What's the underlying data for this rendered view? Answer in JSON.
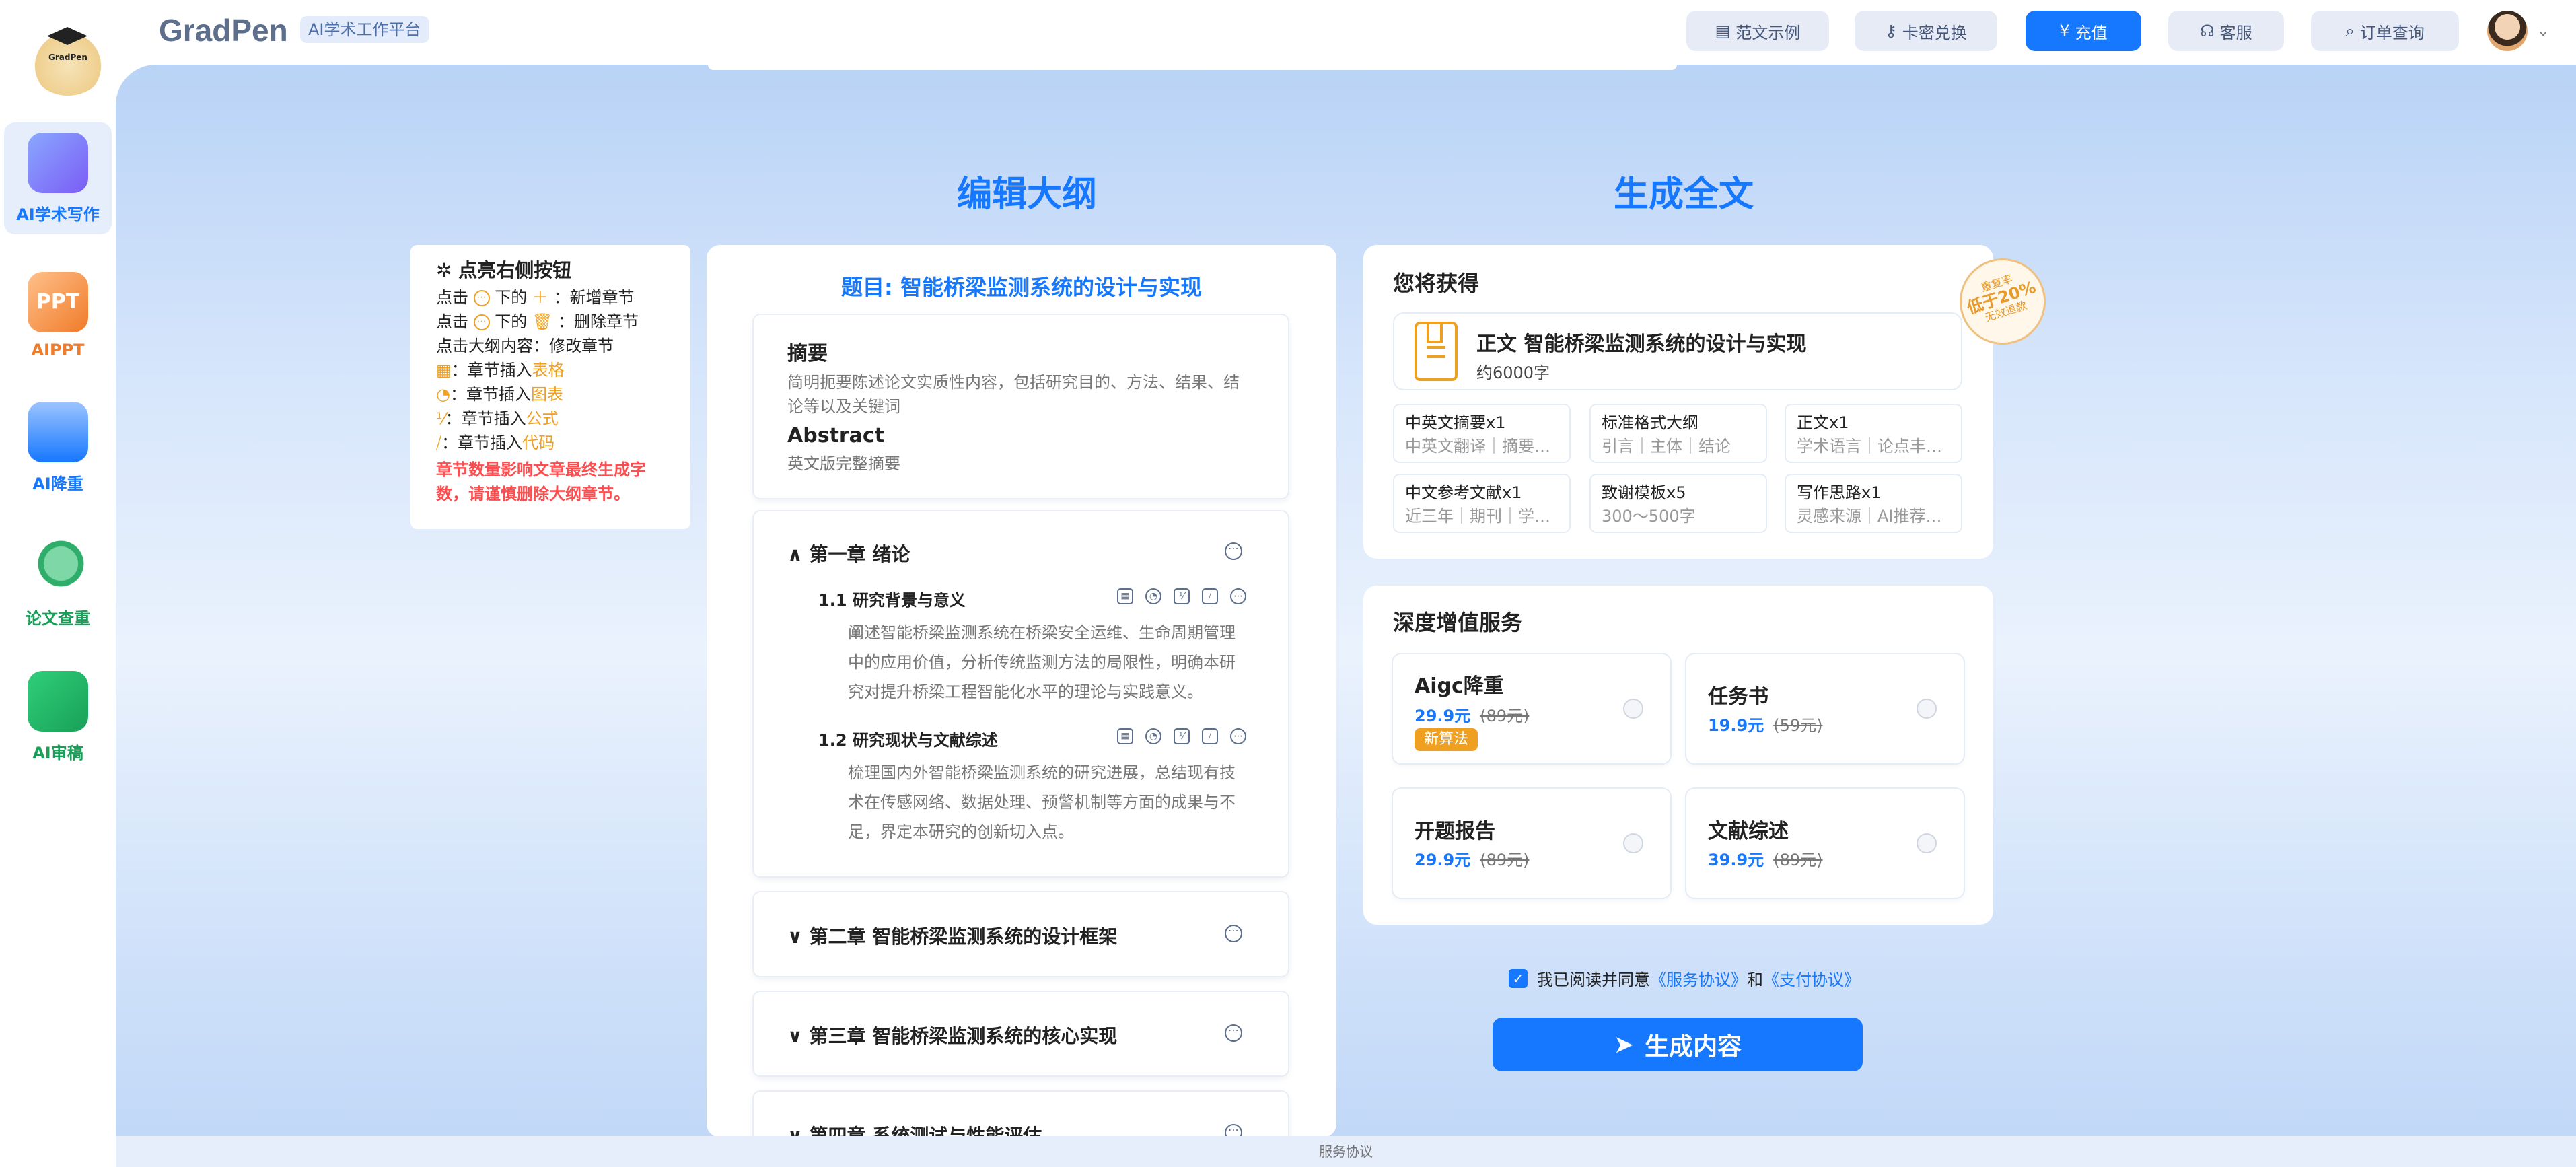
{
  "header": {
    "logo_text": "GradPen",
    "brand": "GradPen",
    "brand_tag": "AI学术工作平台",
    "buttons": {
      "sample": "范文示例",
      "redeem": "卡密兑换",
      "recharge": "充值",
      "service": "客服",
      "orders": "订单查询"
    }
  },
  "sidebar": {
    "items": [
      {
        "label": "AI学术写作",
        "color": "#1677ff"
      },
      {
        "label": "AIPPT",
        "color": "#f07b2a"
      },
      {
        "label": "AI降重",
        "color": "#1677ff"
      },
      {
        "label": "论文查重",
        "color": "#18a058"
      },
      {
        "label": "AI审稿",
        "color": "#18a058"
      }
    ],
    "ppt_icon_text": "PPT"
  },
  "sections": {
    "edit_outline": "编辑大纲",
    "generate_full": "生成全文"
  },
  "hint": {
    "title": "点亮右侧按钮",
    "line1_a": "点击",
    "line1_b": "下的",
    "line1_c": "：新增章节",
    "line2_a": "点击",
    "line2_b": "下的",
    "line2_c": "：删除章节",
    "line3": "点击大纲内容：修改章节",
    "ins_prefix": "：章节插入",
    "ins_table": "表格",
    "ins_chart": "图表",
    "ins_formula": "公式",
    "ins_code": "代码",
    "warning": "章节数量影响文章最终生成字数，请谨慎删除大纲章节。"
  },
  "outline": {
    "title": "题目: 智能桥梁监测系统的设计与实现",
    "abstract_h": "摘要",
    "abstract_p": "简明扼要陈述论文实质性内容，包括研究目的、方法、结果、结论等以及关键词",
    "abstract_en_h": "Abstract",
    "abstract_en_p": "英文版完整摘要",
    "chapter1": {
      "title": "第一章  绪论",
      "sections": [
        {
          "title": "1.1  研究背景与意义",
          "body": "阐述智能桥梁监测系统在桥梁安全运维、生命周期管理中的应用价值，分析传统监测方法的局限性，明确本研究对提升桥梁工程智能化水平的理论与实践意义。"
        },
        {
          "title": "1.2  研究现状与文献综述",
          "body": "梳理国内外智能桥梁监测系统的研究进展，总结现有技术在传感网络、数据处理、预警机制等方面的成果与不足，界定本研究的创新切入点。"
        }
      ]
    },
    "chapter2": "第二章  智能桥梁监测系统的设计框架",
    "chapter3": "第三章  智能桥梁监测系统的核心实现",
    "chapter4": "第四章  系统测试与性能评估"
  },
  "gets": {
    "title": "您将获得",
    "main_title": "正文 智能桥梁监测系统的设计与实现",
    "main_sub": "约6000字",
    "stamp_line1": "重复率",
    "stamp_line2": "低于20%",
    "stamp_line3": "无效退款",
    "features": [
      {
        "title": "中英文摘要x1",
        "sub": "中英文翻译｜摘要…"
      },
      {
        "title": "标准格式大纲",
        "sub": "引言｜主体｜结论"
      },
      {
        "title": "正文x1",
        "sub": "学术语言｜论点丰…"
      },
      {
        "title": "中文参考文献x1",
        "sub": "近三年｜期刊｜学…"
      },
      {
        "title": "致谢模板x5",
        "sub": "300～500字"
      },
      {
        "title": "写作思路x1",
        "sub": "灵感来源｜AI推荐…"
      }
    ]
  },
  "deep": {
    "title": "深度增值服务",
    "services": [
      {
        "name": "Aigc降重",
        "price": "29.9元",
        "old": "(89元)",
        "badge": "新算法"
      },
      {
        "name": "任务书",
        "price": "19.9元",
        "old": "(59元)"
      },
      {
        "name": "开题报告",
        "price": "29.9元",
        "old": "(89元)"
      },
      {
        "name": "文献综述",
        "price": "39.9元",
        "old": "(89元)"
      }
    ]
  },
  "agreement": {
    "prefix": "我已阅读并同意",
    "service_link": "《服务协议》",
    "and": "和",
    "pay_link": "《支付协议》"
  },
  "generate_button": "生成内容",
  "footer": "服务协议"
}
